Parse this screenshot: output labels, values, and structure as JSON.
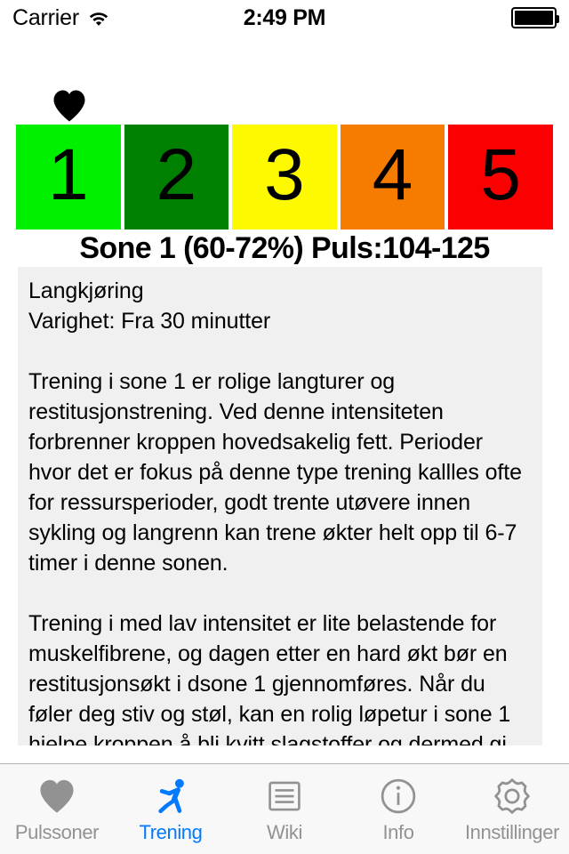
{
  "status_bar": {
    "carrier": "Carrier",
    "wifi_icon": "wifi-icon",
    "time": "2:49 PM",
    "battery_icon": "battery-full-icon"
  },
  "zone_selector": {
    "marker_icon": "heart-icon",
    "selected_zone": 1,
    "zones": [
      {
        "label": "1",
        "color": "#00f000",
        "text_color": "#000000"
      },
      {
        "label": "2",
        "color": "#008000",
        "text_color": "#000000"
      },
      {
        "label": "3",
        "color": "#fcf900",
        "text_color": "#000000"
      },
      {
        "label": "4",
        "color": "#f57c00",
        "text_color": "#000000"
      },
      {
        "label": "5",
        "color": "#fa0000",
        "text_color": "#000000"
      }
    ]
  },
  "heading": "Sone 1 (60-72%) Puls:104-125",
  "description": {
    "body": "Langkjøring\nVarighet: Fra 30 minutter\n\nTrening i sone 1 er rolige langturer og restitusjonstrening. Ved denne intensiteten forbrenner kroppen hovedsakelig fett. Perioder hvor det er fokus på denne type trening kallles ofte for ressursperioder, godt trente utøvere innen sykling og langrenn kan trene økter helt opp til 6-7 timer i denne sonen.\n\nTrening i med lav intensitet er lite belastende for muskelfibrene, og dagen etter en hard økt bør en restitusjonsøkt i dsone 1 gjennomføres. Når du føler deg stiv og støl, kan en rolig løpetur i sone 1 hjelpe kroppen å bli kvitt slagstoffer og dermed gi deg en bedre følelse i beina på neste økt.\n\nDet er hovedsakelig to ting du forbedrer når du"
  },
  "tab_bar": {
    "active_color": "#007aff",
    "inactive_color": "#929292",
    "items": [
      {
        "label": "Pulssoner",
        "icon": "heart-icon",
        "active": false
      },
      {
        "label": "Trening",
        "icon": "running-person-icon",
        "active": true
      },
      {
        "label": "Wiki",
        "icon": "document-lines-icon",
        "active": false
      },
      {
        "label": "Info",
        "icon": "info-circle-icon",
        "active": false
      },
      {
        "label": "Innstillinger",
        "icon": "gear-icon",
        "active": false
      }
    ]
  }
}
